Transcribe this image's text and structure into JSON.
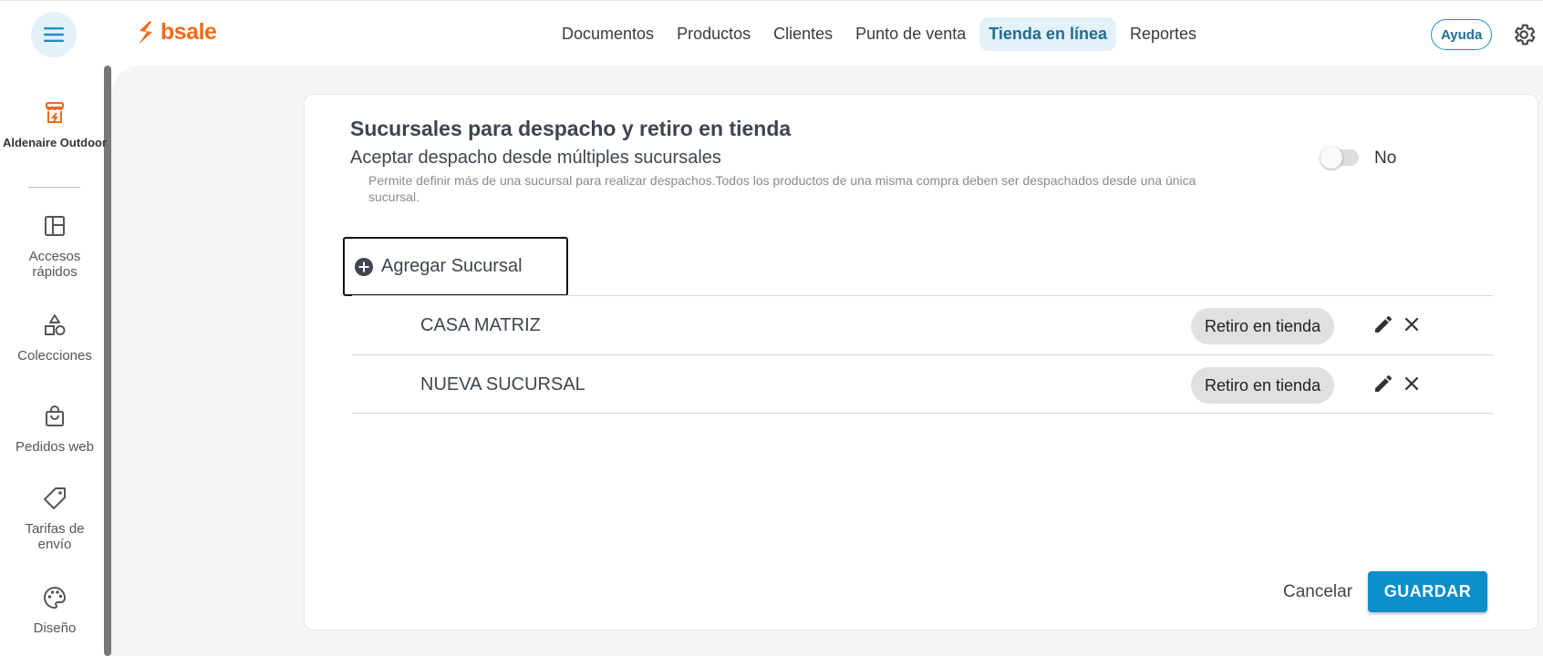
{
  "header": {
    "logo_text": "bsale",
    "nav": [
      {
        "label": "Documentos",
        "active": false
      },
      {
        "label": "Productos",
        "active": false
      },
      {
        "label": "Clientes",
        "active": false
      },
      {
        "label": "Punto de venta",
        "active": false
      },
      {
        "label": "Tienda en línea",
        "active": true
      },
      {
        "label": "Reportes",
        "active": false
      }
    ],
    "help_label": "Ayuda",
    "settings_icon": "gear-icon",
    "menu_icon": "hamburger-icon"
  },
  "sidebar": {
    "store_name": "Aldenaire Outdoor",
    "items": [
      {
        "label": "Accesos rápidos",
        "icon": "layout-icon"
      },
      {
        "label": "Colecciones",
        "icon": "shapes-icon"
      },
      {
        "label": "Pedidos web",
        "icon": "shopping-bag-icon"
      },
      {
        "label": "Tarifas de envío",
        "icon": "tag-icon"
      },
      {
        "label": "Diseño",
        "icon": "palette-icon"
      }
    ]
  },
  "main": {
    "title": "Sucursales para despacho y retiro en tienda",
    "subtitle": "Aceptar despacho desde múltiples sucursales",
    "description": "Permite definir más de una sucursal para realizar despachos.Todos los productos de una misma compra deben ser despachados desde una única sucursal.",
    "toggle_label": "No",
    "toggle_on": false,
    "add_branch_label": "Agregar Sucursal",
    "branches": [
      {
        "name": "CASA MATRIZ",
        "tag": "Retiro en tienda"
      },
      {
        "name": "NUEVA SUCURSAL",
        "tag": "Retiro en tienda"
      }
    ],
    "cancel_label": "Cancelar",
    "save_label": "GUARDAR"
  },
  "colors": {
    "brand": "#f26a1b",
    "accent": "#0b8ec9",
    "nav_active_bg": "#e3f1f8"
  }
}
